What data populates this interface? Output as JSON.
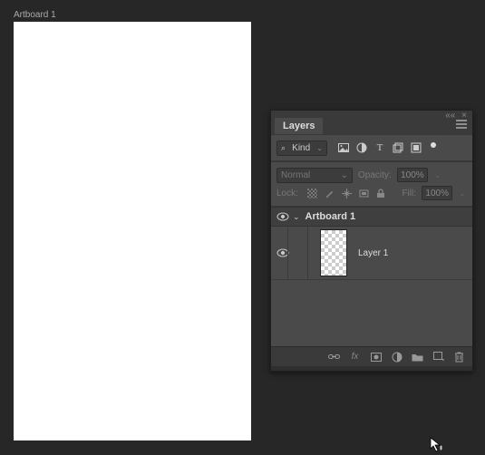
{
  "artboard": {
    "label": "Artboard 1"
  },
  "panel": {
    "title": "Layers",
    "filter": {
      "kind_label": "Kind",
      "icons": [
        "image",
        "adjustment",
        "type",
        "shape",
        "smartobject"
      ]
    },
    "blend": {
      "mode": "Normal",
      "opacity_label": "Opacity:",
      "opacity_value": "100%"
    },
    "lock": {
      "label": "Lock:",
      "fill_label": "Fill:",
      "fill_value": "100%"
    },
    "layers": {
      "artboard_name": "Artboard 1",
      "items": [
        {
          "name": "Layer 1"
        }
      ]
    },
    "footer_icons": [
      "link",
      "fx",
      "mask",
      "adjustment",
      "group",
      "new",
      "trash"
    ]
  }
}
